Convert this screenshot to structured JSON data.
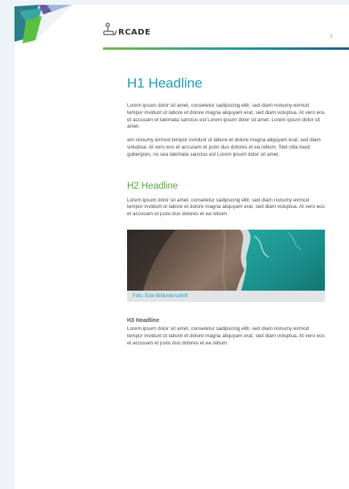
{
  "header": {
    "logo_text": "RCADE",
    "page_number": "1"
  },
  "content": {
    "h1": "H1 Headline",
    "paragraph_1": "Lorem ipsum dolor sit amet, consetetur sadipscing elitr, sed diam nonumy eirmod tempor invidunt ut labore et dolore magna aliquyam erat, sed diam voluptua. At vero eos et accusam et takimata sanctus est Lorem ipsum dolor sit amet. Lorem ipsum dolor sit amet.",
    "paragraph_2": "am nonumy eirmod tempor invidunt ut labore et dolore magna aliquyam erat, sed diam voluptua. At vero eos et accusam et justo duo dolores et ea rebum. Stet clita kasd gubergren, no sea takimata sanctus est Lorem ipsum dolor sit amet.",
    "h2": "H2 Headline",
    "paragraph_3": "Lorem ipsum dolor sit amet, consetetur sadipscing elitr, sed diam nonumy eirmod tempor invidunt ut labore et dolore magna aliquyam erat, sed diam voluptua. At vero eos et accusam et justo duo dolores et ea rebum.",
    "figure_caption": "Foto: Eine Bildunterschrift",
    "h3": "H3 Headline",
    "paragraph_4": "Lorem ipsum dolor sit amet, consetetur sadipscing elitr, sed diam nonumy eirmod tempor invidunt ut labore et dolore magna aliquyam erat, sed diam voluptua. At vero eos et accusam et justo duo dolores et ea rebum."
  },
  "colors": {
    "accent_blue": "#1f9bb3",
    "accent_green": "#5aa34a",
    "page_background": "#eef3f8"
  }
}
